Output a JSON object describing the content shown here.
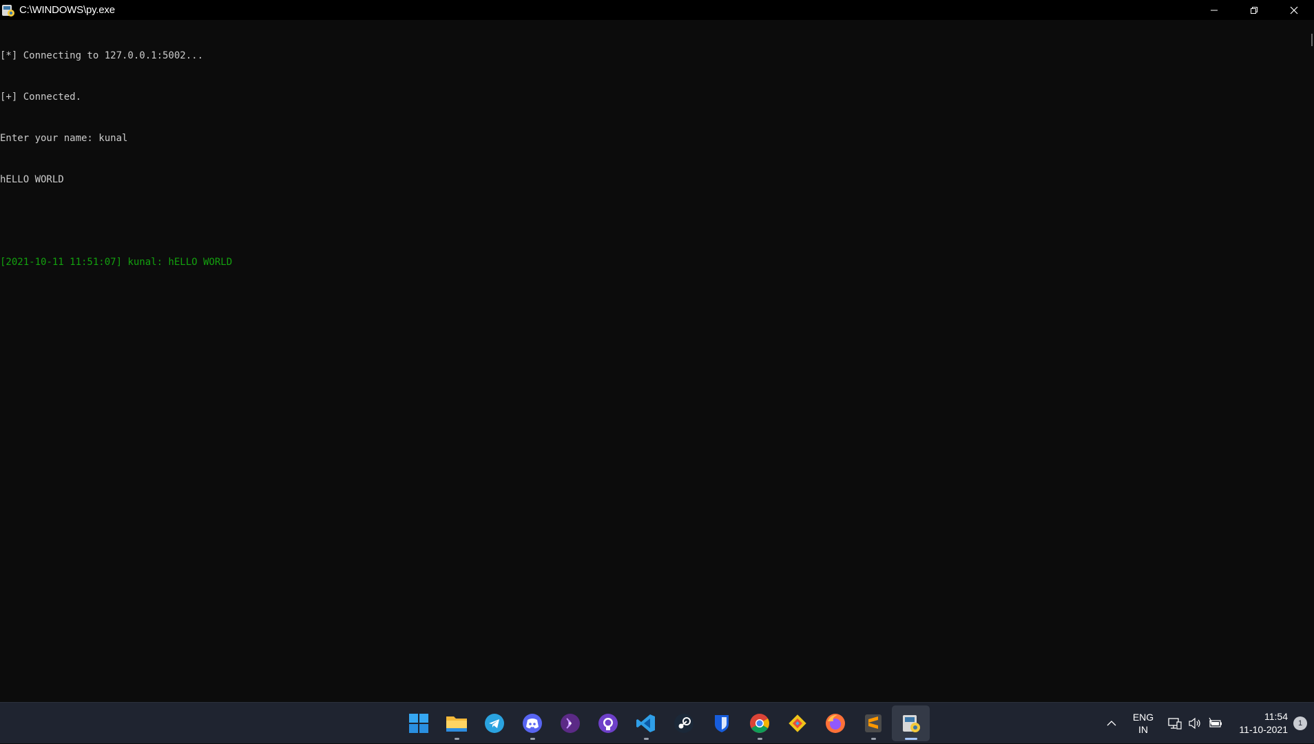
{
  "window": {
    "title": "C:\\WINDOWS\\py.exe"
  },
  "console": {
    "lines": [
      {
        "text": "[*] Connecting to 127.0.0.1:5002...",
        "color": "#cccccc"
      },
      {
        "text": "[+] Connected.",
        "color": "#cccccc"
      },
      {
        "text": "Enter your name: kunal",
        "color": "#cccccc"
      },
      {
        "text": "hELLO WORLD",
        "color": "#cccccc"
      },
      {
        "text": "",
        "color": "#cccccc"
      },
      {
        "text": "[2021-10-11 11:51:07] kunal: hELLO WORLD",
        "color": "#13a10e"
      }
    ]
  },
  "taskbar": {
    "apps": [
      {
        "name": "start-icon",
        "running": false
      },
      {
        "name": "file-explorer-icon",
        "running": true
      },
      {
        "name": "telegram-icon",
        "running": false
      },
      {
        "name": "discord-icon",
        "running": true
      },
      {
        "name": "podcast-icon",
        "running": false
      },
      {
        "name": "github-icon",
        "running": false
      },
      {
        "name": "vscode-icon",
        "running": true
      },
      {
        "name": "steam-icon",
        "running": false
      },
      {
        "name": "bitwarden-icon",
        "running": false
      },
      {
        "name": "chrome-icon",
        "running": true
      },
      {
        "name": "git-gui-icon",
        "running": false
      },
      {
        "name": "firefox-icon",
        "running": false
      },
      {
        "name": "sublime-text-icon",
        "running": true
      },
      {
        "name": "python-launcher-icon",
        "running": true,
        "active": true
      }
    ],
    "tray": {
      "lang_top": "ENG",
      "lang_bottom": "IN",
      "time": "11:54",
      "date": "11-10-2021",
      "notifications": "1"
    }
  },
  "colors": {
    "console_bg": "#0c0c0c",
    "console_text": "#cccccc",
    "green_text": "#13a10e",
    "taskbar_bg": "#1f2430"
  }
}
